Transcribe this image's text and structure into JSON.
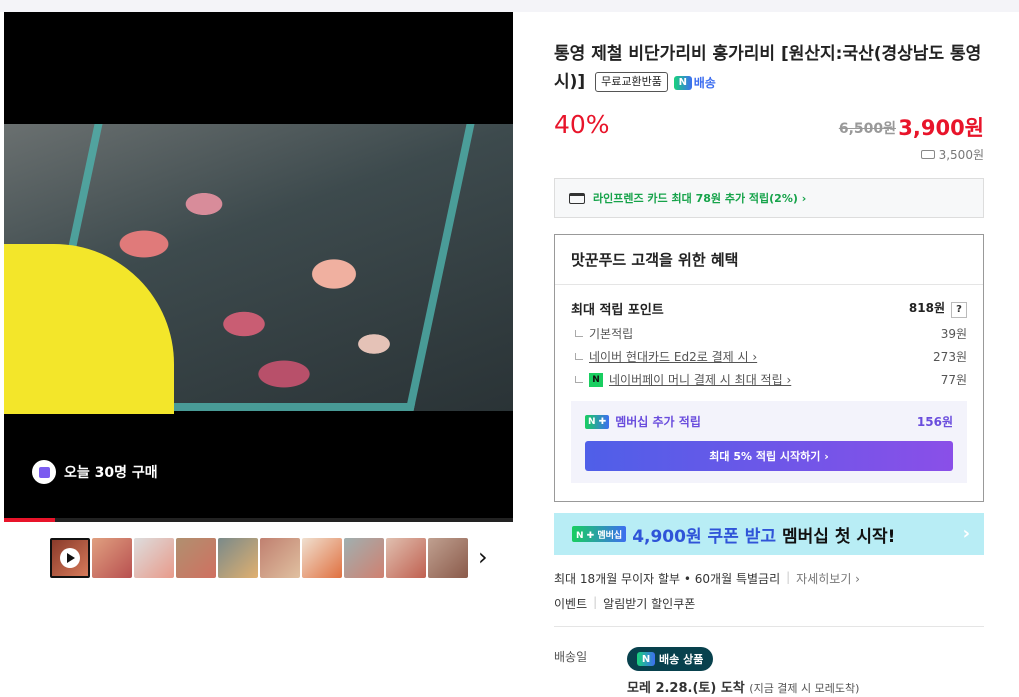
{
  "product": {
    "title": "통영 제철 비단가리비 홍가리비 [원산지:국산(경상남도 통영시)]",
    "tag_free_return": "무료교환반품",
    "npay_delivery": "배송",
    "discount_rate": "40%",
    "original_price": "6,500원",
    "sale_price": "3,900원",
    "shipping_fee": "3,500원"
  },
  "media": {
    "purchase_text": "오늘 30명 구매",
    "progress_fraction": 0.1,
    "thumbnail_count": 10
  },
  "card_promo": {
    "text": "라인프렌즈 카드 최대 78원 추가 적립(2%) ›"
  },
  "benefit": {
    "heading": "맛꾼푸드 고객을 위한 혜택",
    "max_points_label": "최대 적립 포인트",
    "max_points_value": "818원",
    "help_icon": "?",
    "rows": [
      {
        "label": "기본적립",
        "value": "39원"
      },
      {
        "label": "네이버 현대카드 Ed2로 결제 시 ›",
        "value": "273원"
      },
      {
        "label": "네이버페이 머니 결제 시 최대 적립 ›",
        "value": "77원"
      }
    ],
    "npay_icon": "N",
    "membership": {
      "badge": "N ✚",
      "label": "멤버십 추가 적립",
      "value": "156원",
      "button": "최대 5% 적립 시작하기 ›"
    }
  },
  "banner": {
    "chip": "N ✚ 멤버십",
    "highlight": "4,900원 쿠폰 받고",
    "rest": "멤버십 첫 시작!",
    "arrow": "›"
  },
  "installment": {
    "text": "최대 18개월 무이자 할부 • 60개월 특별금리",
    "detail": "자세히보기 ›"
  },
  "events": {
    "event": "이벤트",
    "coupon": "알림받기 할인쿠폰"
  },
  "delivery": {
    "label": "배송일",
    "badge": "배송 상품",
    "arrival": "모레 2.28.(토) 도착",
    "arrival_sub": "(지금 결제 시 모레도착)"
  },
  "colors": {
    "accent_red": "#e8142a",
    "npay_green": "#19ce60",
    "member_purple": "#6a4ddd"
  }
}
